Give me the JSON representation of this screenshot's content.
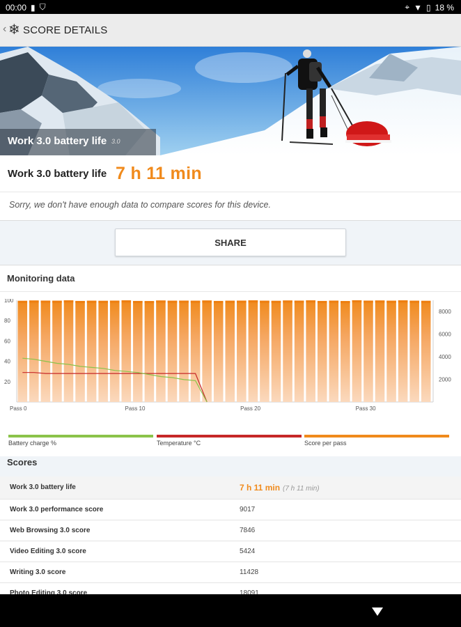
{
  "status_bar": {
    "time": "00:00",
    "battery_percent": "18 %"
  },
  "app_bar": {
    "title": "SCORE DETAILS"
  },
  "hero": {
    "title": "Work 3.0 battery life",
    "version": "3.0"
  },
  "result": {
    "label": "Work 3.0 battery life",
    "value": "7 h 11 min"
  },
  "notice": "Sorry, we don't have enough data to compare scores for this device.",
  "share_label": "SHARE",
  "monitoring": {
    "title": "Monitoring data",
    "legend": [
      {
        "label": "Battery charge %",
        "color": "#8bc34a"
      },
      {
        "label": "Temperature °C",
        "color": "#c62828"
      },
      {
        "label": "Score per pass",
        "color": "#f08a1c"
      }
    ]
  },
  "chart_data": {
    "type": "bar",
    "left_axis": {
      "ticks": [
        "100",
        "80",
        "60",
        "40",
        "20"
      ],
      "ylim": [
        0,
        100
      ]
    },
    "right_axis": {
      "ticks": [
        "8000",
        "6000",
        "4000",
        "2000"
      ],
      "ylim": [
        0,
        9000
      ]
    },
    "x_axis": {
      "ticks": [
        "Pass 0",
        "Pass 10",
        "Pass 20",
        "Pass 30"
      ],
      "tick_positions": [
        0,
        10,
        20,
        30
      ]
    },
    "passes": 36,
    "series": [
      {
        "name": "Score per pass",
        "axis": "right",
        "color": "#f08a1c",
        "values": [
          8950,
          8980,
          8970,
          8960,
          8990,
          8940,
          8960,
          8950,
          8970,
          8990,
          8940,
          8930,
          8980,
          8960,
          8970,
          8960,
          8980,
          8940,
          8960,
          8970,
          8990,
          8960,
          8950,
          8980,
          8970,
          8990,
          8940,
          8970,
          8930,
          9000,
          8970,
          8980,
          8960,
          8990,
          8960,
          8950
        ]
      },
      {
        "name": "Battery charge %",
        "axis": "left",
        "color": "#8bc34a",
        "values": [
          43,
          42,
          40,
          38,
          37,
          35,
          34,
          33,
          31,
          30,
          29,
          27,
          25,
          24,
          22,
          21,
          0
        ]
      },
      {
        "name": "Temperature °C",
        "axis": "left",
        "color": "#c62828",
        "values": [
          29,
          29,
          28,
          28,
          28,
          28,
          28,
          28,
          28,
          28,
          28,
          28,
          28,
          28,
          28,
          28,
          0
        ]
      }
    ]
  },
  "scores": {
    "title": "Scores",
    "rows": [
      {
        "label": "Work 3.0 battery life",
        "value": "7 h 11 min",
        "sub": "(7 h 11 min)"
      },
      {
        "label": "Work 3.0 performance score",
        "value": "9017"
      },
      {
        "label": "Web Browsing 3.0 score",
        "value": "7846"
      },
      {
        "label": "Video Editing 3.0 score",
        "value": "5424"
      },
      {
        "label": "Writing 3.0 score",
        "value": "11428"
      },
      {
        "label": "Photo Editing 3.0 score",
        "value": "18091"
      }
    ]
  }
}
